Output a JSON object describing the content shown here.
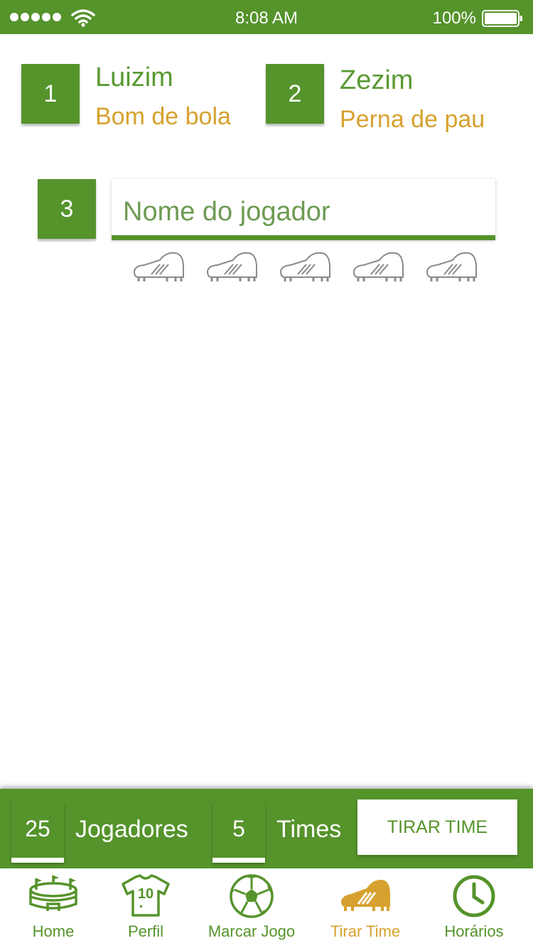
{
  "status_bar": {
    "time": "8:08 AM",
    "battery": "100%"
  },
  "players": [
    {
      "number": "1",
      "name": "Luizim",
      "skill": "Bom de bola"
    },
    {
      "number": "2",
      "name": "Zezim",
      "skill": "Perna de pau"
    }
  ],
  "new_player": {
    "number": "3",
    "placeholder": "Nome do jogador",
    "value": ""
  },
  "summary": {
    "players_count": "25",
    "players_label": "Jogadores",
    "teams_count": "5",
    "teams_label": "Times",
    "button_label": "TIRAR TIME"
  },
  "tabs": [
    {
      "label": "Home",
      "icon": "stadium-icon"
    },
    {
      "label": "Perfil",
      "icon": "jersey-icon"
    },
    {
      "label": "Marcar Jogo",
      "icon": "soccer-ball-icon"
    },
    {
      "label": "Tirar Time",
      "icon": "cleat-icon",
      "active": true
    },
    {
      "label": "Horários",
      "icon": "clock-icon"
    }
  ],
  "colors": {
    "primary": "#55932b",
    "accent": "#d6a12e",
    "icon_gray": "#8a8a8a"
  }
}
